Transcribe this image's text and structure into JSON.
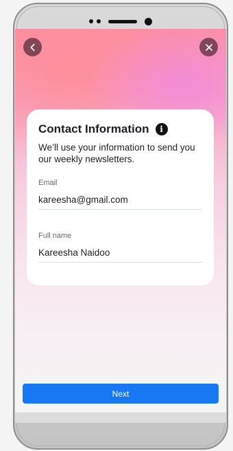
{
  "nav": {
    "back_icon": "chevron-left-icon",
    "close_icon": "close-icon"
  },
  "card": {
    "title": "Contact Information",
    "info_icon": "info-icon",
    "info_glyph": "i",
    "description": "We’ll use your information to send you our weekly newsletters.",
    "fields": [
      {
        "label": "Email",
        "value": "kareesha@gmail.com"
      },
      {
        "label": "Full name",
        "value": "Kareesha Naidoo"
      }
    ]
  },
  "footer": {
    "next_label": "Next"
  },
  "colors": {
    "accent": "#1877f2",
    "nav_button_bg": "#5a2d3c"
  }
}
